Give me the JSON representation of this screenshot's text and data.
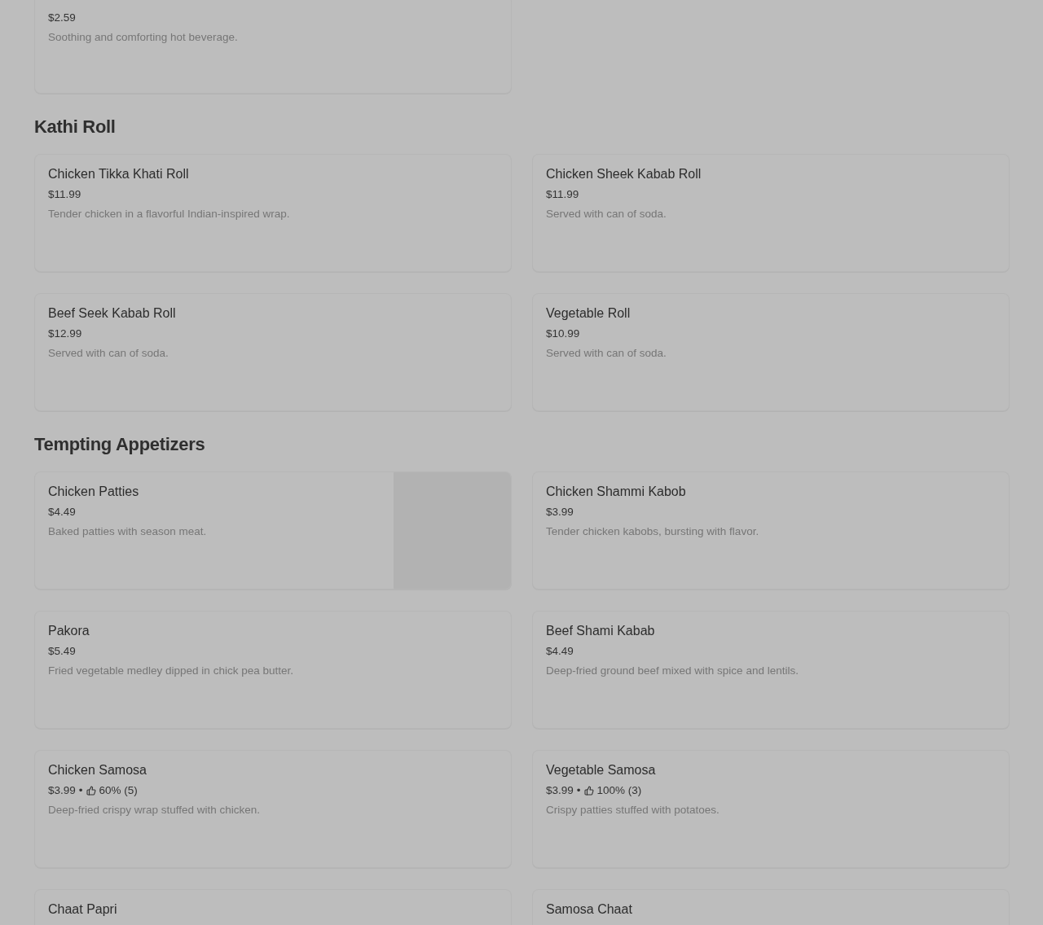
{
  "sections": [
    {
      "items": [
        {
          "price": "$2.59",
          "description": "Soothing and comforting hot beverage.",
          "photo": false
        }
      ]
    },
    {
      "title": "Kathi Roll",
      "items": [
        {
          "name": "Chicken Tikka Khati Roll",
          "price": "$11.99",
          "description": "Tender chicken in a flavorful Indian-inspired wrap.",
          "photo": false
        },
        {
          "name": "Chicken Sheek Kabab Roll",
          "price": "$11.99",
          "description": "Served with can of soda.",
          "photo": false
        },
        {
          "name": "Beef Seek Kabab Roll",
          "price": "$12.99",
          "description": "Served with can of soda.",
          "photo": false
        },
        {
          "name": "Vegetable Roll",
          "price": "$10.99",
          "description": "Served with can of soda.",
          "photo": false
        }
      ]
    },
    {
      "title": "Tempting Appetizers",
      "items": [
        {
          "name": "Chicken Patties",
          "price": "$4.49",
          "description": "Baked patties with season meat.",
          "photo": true
        },
        {
          "name": "Chicken Shammi Kabob",
          "price": "$3.99",
          "description": "Tender chicken kabobs, bursting with flavor.",
          "photo": false
        },
        {
          "name": "Pakora",
          "price": "$5.49",
          "description": "Fried vegetable medley dipped in chick pea butter.",
          "photo": false
        },
        {
          "name": "Beef Shami Kabab",
          "price": "$4.49",
          "description": "Deep-fried ground beef mixed with spice and lentils.",
          "photo": false
        },
        {
          "name": "Chicken Samosa",
          "price": "$3.99",
          "rating": {
            "separator": "•",
            "text": "60% (5)"
          },
          "description": "Deep-fried crispy wrap stuffed with chicken.",
          "photo": false
        },
        {
          "name": "Vegetable Samosa",
          "price": "$3.99",
          "rating": {
            "separator": "•",
            "text": "100% (3)"
          },
          "description": "Crispy patties stuffed with potatoes.",
          "photo": false
        },
        {
          "name": "Chaat Papri",
          "photo": false
        },
        {
          "name": "Samosa Chaat",
          "photo": false
        }
      ]
    }
  ]
}
